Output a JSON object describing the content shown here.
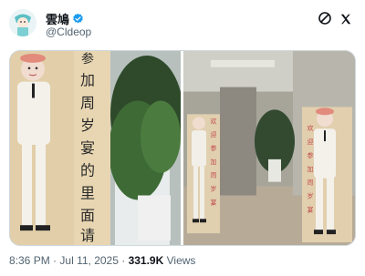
{
  "author": {
    "display_name": "雲鳩",
    "handle": "@Cldeop",
    "verified": true,
    "verified_color": "#1d9bf0"
  },
  "header": {
    "more_icon": "more-icon",
    "x_logo_icon": "x-logo-icon"
  },
  "media": {
    "standee_text": "参加周岁宴的里面请",
    "standee_text_right": "欢迎参加周岁宴"
  },
  "footer": {
    "time": "8:36 PM",
    "separator": "·",
    "date": "Jul 11, 2025",
    "views_count": "331.9K",
    "views_label": "Views"
  }
}
